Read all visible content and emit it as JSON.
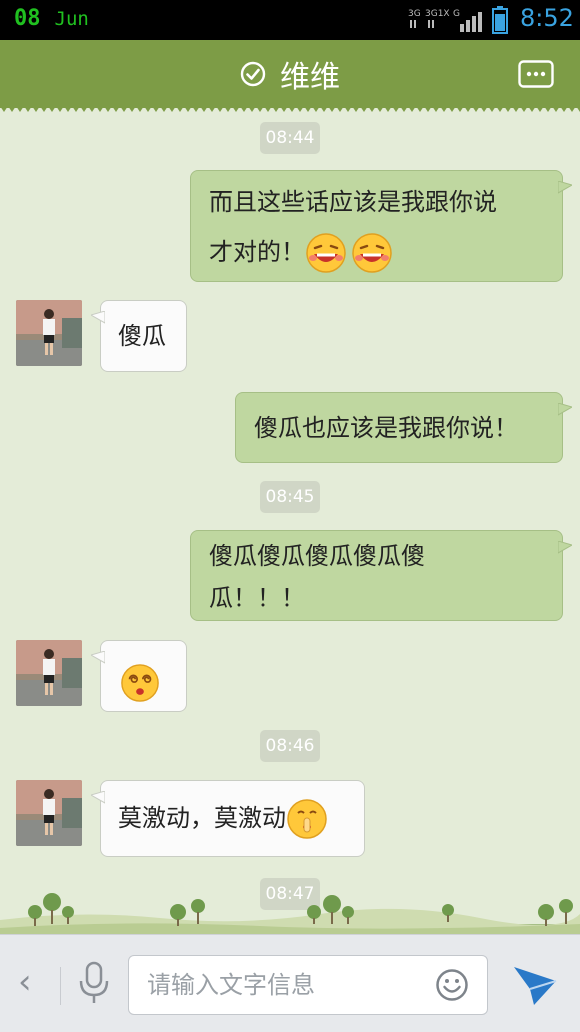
{
  "status_bar": {
    "day": "08",
    "month": "Jun",
    "time": "8:52",
    "network_icons": [
      "3G",
      "3G1X",
      "G"
    ]
  },
  "header": {
    "title": "维维",
    "verified_icon": "check-circle-icon",
    "more_icon": "more-dots-icon"
  },
  "chat": {
    "timestamps": [
      "08:44",
      "08:45",
      "08:46",
      "08:47"
    ],
    "messages": [
      {
        "sender": "me",
        "line1": "而且这些话应该是我跟你说",
        "line2": "才对的！",
        "emoji": [
          "laugh-emoji",
          "laugh-emoji"
        ]
      },
      {
        "sender": "them",
        "text": "傻瓜"
      },
      {
        "sender": "me",
        "text": "傻瓜也应该是我跟你说！"
      },
      {
        "sender": "me",
        "line1": "傻瓜傻瓜傻瓜傻瓜傻",
        "line2": "瓜！！！"
      },
      {
        "sender": "them",
        "emoji": [
          "dizzy-emoji"
        ]
      },
      {
        "sender": "them",
        "text": "莫激动，莫激动",
        "emoji": [
          "shush-emoji"
        ]
      }
    ]
  },
  "input_bar": {
    "placeholder": "请输入文字信息",
    "value": ""
  },
  "colors": {
    "header_green": "#7d9c46",
    "outgoing_bubble": "#bfd7a0",
    "incoming_bubble": "#fbfbfb",
    "status_time": "#3aa3e0",
    "status_date": "#20c020",
    "send_blue": "#2a79c8"
  }
}
